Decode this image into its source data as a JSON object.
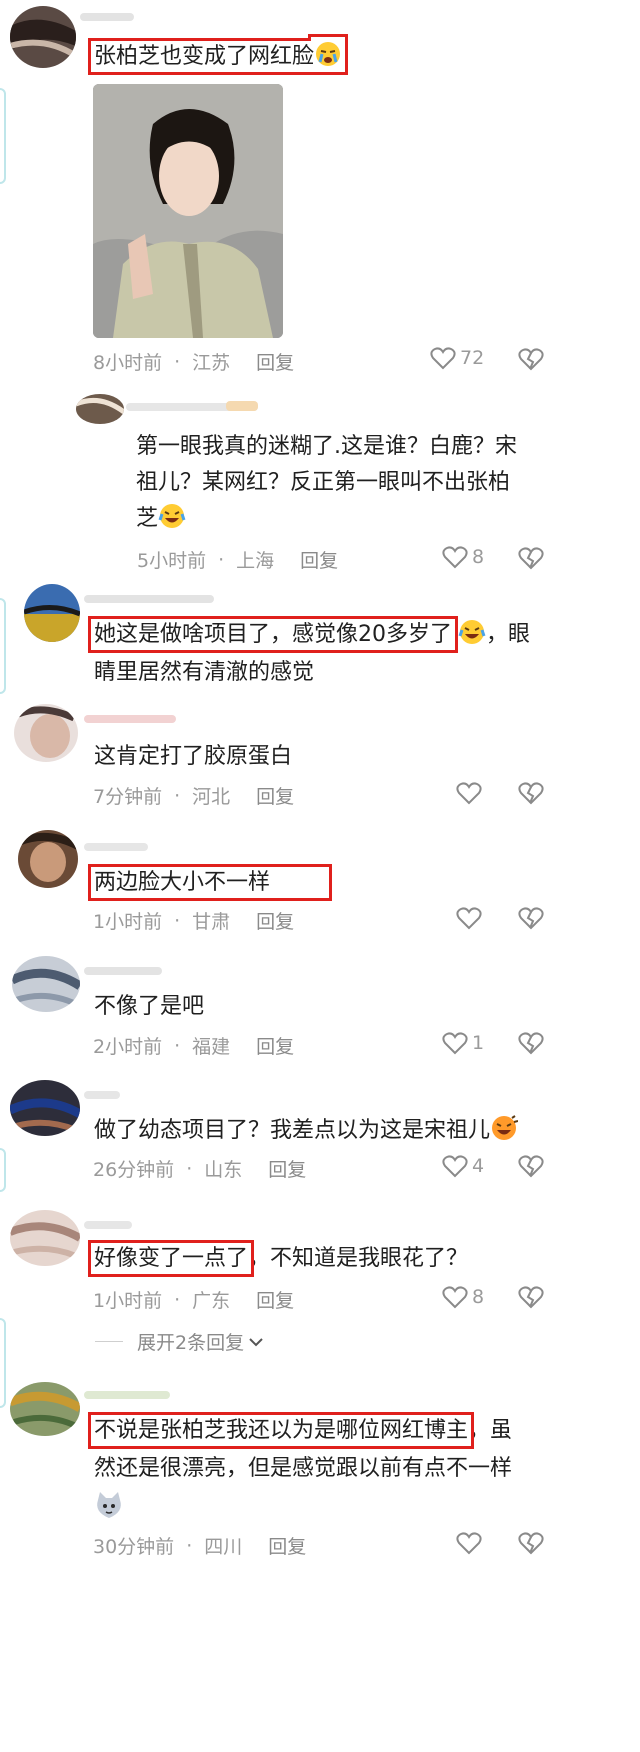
{
  "comments": [
    {
      "text": "张柏芝也变成了网红脸",
      "time": "8小时前",
      "location": "江苏",
      "reply": "回复",
      "likes": "72"
    },
    {
      "text_line1": "第一眼我真的迷糊了.这是谁？白鹿？宋",
      "text_line2": "祖儿？某网红？反正第一眼叫不出张柏",
      "text_line3": "芝",
      "time": "5小时前",
      "location": "上海",
      "reply": "回复",
      "likes": "8"
    },
    {
      "text_highlight": "她这是做啥项目了，感觉像20多岁了",
      "text_rest": "，眼",
      "text_line2": "睛里居然有清澈的感觉"
    },
    {
      "text": "这肯定打了胶原蛋白",
      "time": "7分钟前",
      "location": "河北",
      "reply": "回复"
    },
    {
      "text": "两边脸大小不一样",
      "time": "1小时前",
      "location": "甘肃",
      "reply": "回复"
    },
    {
      "text": "不像了是吧",
      "time": "2小时前",
      "location": "福建",
      "reply": "回复",
      "likes": "1"
    },
    {
      "text": "做了幼态项目了？我差点以为这是宋祖儿",
      "time": "26分钟前",
      "location": "山东",
      "reply": "回复",
      "likes": "4"
    },
    {
      "text_highlight": "好像变了一点了",
      "text_rest": "，不知道是我眼花了？",
      "time": "1小时前",
      "location": "广东",
      "reply": "回复",
      "likes": "8"
    },
    {
      "text_highlight": "不说是张柏芝我还以为是哪位网红博主",
      "text_rest": "，虽",
      "text_line2": "然还是很漂亮，但是感觉跟以前有点不一样",
      "time": "30分钟前",
      "location": "四川",
      "reply": "回复"
    }
  ],
  "expand_replies": "展开2条回复",
  "separator": "·",
  "colors": {
    "highlight_box": "#e0201c",
    "meta_text": "#9a9a9a",
    "body_text": "#202020"
  },
  "icons": [
    "heart-outline-icon",
    "broken-heart-icon",
    "chevron-down-icon",
    "crying-emoji-icon",
    "laughing-tears-emoji-icon",
    "cat-emoji-icon"
  ]
}
